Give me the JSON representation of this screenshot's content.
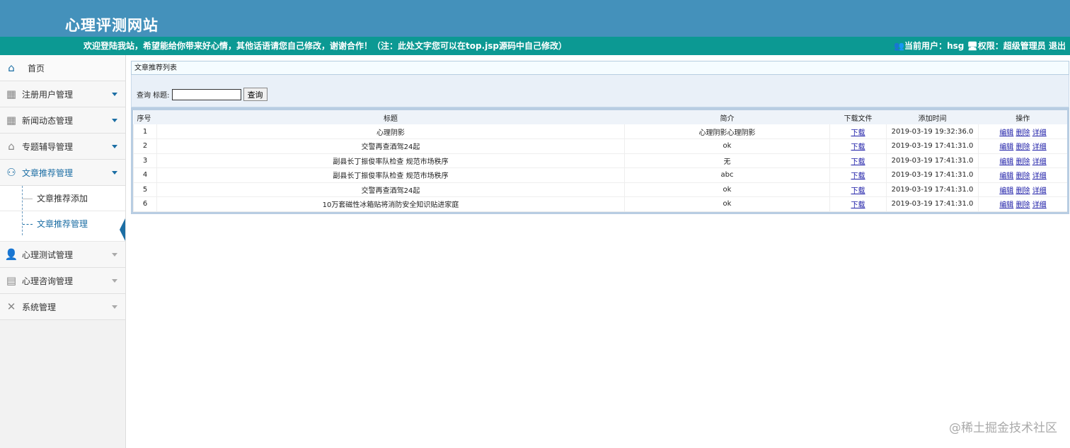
{
  "header": {
    "title": "心理评测网站"
  },
  "topbar": {
    "welcome": "欢迎登陆我站，希望能给你带来好心情，其他话语请您自己修改，谢谢合作！（注：此处文字您可以在top.jsp源码中自己修改）",
    "user_label": "当前用户：",
    "user": "hsg",
    "role_label": "权限：",
    "role": "超级管理员",
    "logout": "退出"
  },
  "sidebar": {
    "home": "首页",
    "items": [
      "注册用户管理",
      "新闻动态管理",
      "专题辅导管理",
      "文章推荐管理",
      "心理测试管理",
      "心理咨询管理",
      "系统管理"
    ],
    "sub": [
      "文章推荐添加",
      "文章推荐管理"
    ]
  },
  "main": {
    "title": "文章推荐列表",
    "query_label": "查询 标题:",
    "query_value": "",
    "query_button": "查询",
    "columns": [
      "序号",
      "标题",
      "简介",
      "下载文件",
      "添加时间",
      "操作"
    ],
    "rows": [
      [
        "1",
        "心理阴影",
        "心理阴影心理阴影",
        "下载",
        "2019-03-19 19:32:36.0"
      ],
      [
        "2",
        "交警再查酒驾24起",
        "ok",
        "下载",
        "2019-03-19 17:41:31.0"
      ],
      [
        "3",
        "副县长丁振俊率队检查 规范市场秩序",
        "无",
        "下载",
        "2019-03-19 17:41:31.0"
      ],
      [
        "4",
        "副县长丁振俊率队检查 规范市场秩序",
        "abc",
        "下载",
        "2019-03-19 17:41:31.0"
      ],
      [
        "5",
        "交警再查酒驾24起",
        "ok",
        "下载",
        "2019-03-19 17:41:31.0"
      ],
      [
        "6",
        "10万套磁性冰箱贴将消防安全知识贴进家庭",
        "ok",
        "下载",
        "2019-03-19 17:41:31.0"
      ]
    ],
    "actions": [
      "编辑",
      "删除",
      "详细"
    ]
  },
  "watermark": "@稀土掘金技术社区"
}
